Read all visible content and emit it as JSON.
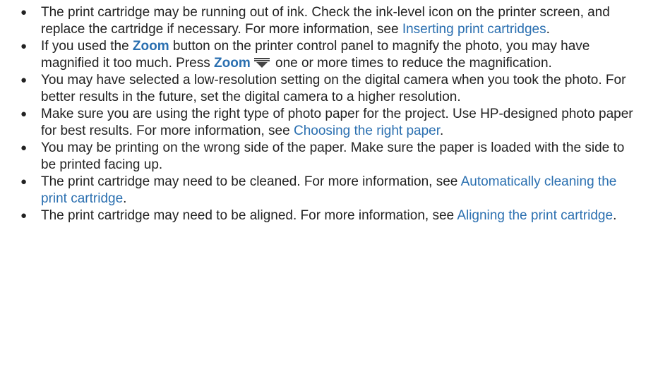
{
  "bullet_char": "●",
  "colors": {
    "text": "#222222",
    "link": "#2a6fb0"
  },
  "items": [
    {
      "t1": "The print cartridge may be running out of ink. Check the ink-level icon on the printer screen, and replace the cartridge if necessary. For more information, see ",
      "link": "Inserting print cartridges",
      "t2": "."
    },
    {
      "t1": "If you used the ",
      "zoom1": "Zoom",
      "t2": " button on the printer control panel to magnify the photo, you may have magnified it too much. Press ",
      "zoom2": "Zoom",
      "icon": "zoom-out-icon",
      "t3": " one or more times to reduce the magnification."
    },
    {
      "t1": "You may have selected a low-resolution setting on the digital camera when you took the photo. For better results in the future, set the digital camera to a higher resolution."
    },
    {
      "t1": "Make sure you are using the right type of photo paper for the project. Use HP-designed photo paper for best results. For more information, see ",
      "link": "Choosing the right paper",
      "t2": "."
    },
    {
      "t1": "You may be printing on the wrong side of the paper. Make sure the paper is loaded with the side to be printed facing up."
    },
    {
      "t1": "The print cartridge may need to be cleaned. For more information, see ",
      "link": "Automatically cleaning the print cartridge",
      "t2": "."
    },
    {
      "t1": "The print cartridge may need to be aligned. For more information, see ",
      "link": "Aligning the print cartridge",
      "t2": "."
    }
  ]
}
